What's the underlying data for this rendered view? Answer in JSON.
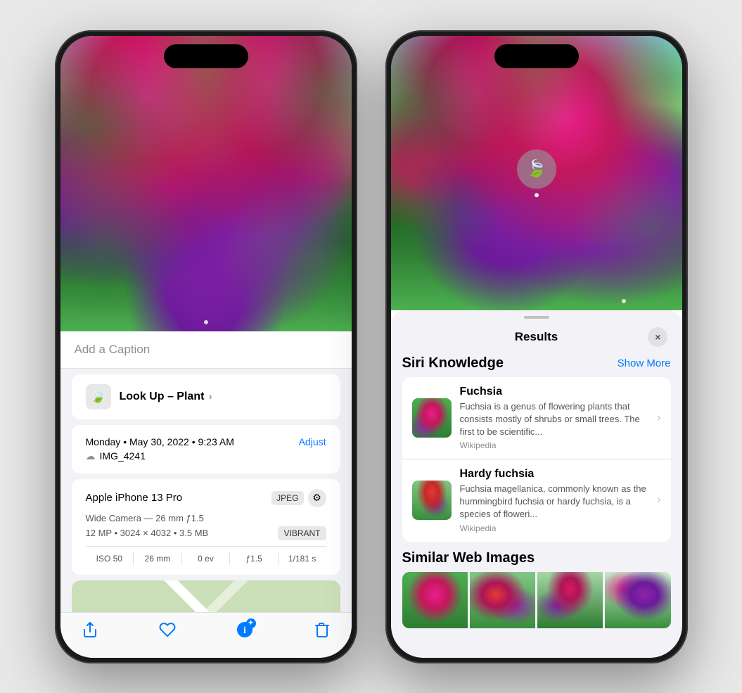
{
  "phone1": {
    "caption_placeholder": "Add a Caption",
    "lookup_label": "Look Up",
    "lookup_type": "Plant",
    "date": "Monday • May 30, 2022 • 9:23 AM",
    "adjust_label": "Adjust",
    "filename": "IMG_4241",
    "camera_model": "Apple iPhone 13 Pro",
    "format_badge": "JPEG",
    "camera_detail": "Wide Camera — 26 mm ƒ1.5",
    "mp_info": "12 MP • 3024 × 4032 • 3.5 MB",
    "vibrant_label": "VIBRANT",
    "exif": {
      "iso": "ISO 50",
      "focal": "26 mm",
      "ev": "0 ev",
      "aperture": "ƒ1.5",
      "shutter": "1/181 s"
    },
    "toolbar": {
      "share_label": "share",
      "favorite_label": "favorite",
      "info_label": "info",
      "delete_label": "delete"
    }
  },
  "phone2": {
    "results_title": "Results",
    "close_label": "×",
    "siri_knowledge_title": "Siri Knowledge",
    "show_more_label": "Show More",
    "items": [
      {
        "title": "Fuchsia",
        "description": "Fuchsia is a genus of flowering plants that consists mostly of shrubs or small trees. The first to be scientific...",
        "source": "Wikipedia"
      },
      {
        "title": "Hardy fuchsia",
        "description": "Fuchsia magellanica, commonly known as the hummingbird fuchsia or hardy fuchsia, is a species of floweri...",
        "source": "Wikipedia"
      }
    ],
    "similar_title": "Similar Web Images"
  }
}
